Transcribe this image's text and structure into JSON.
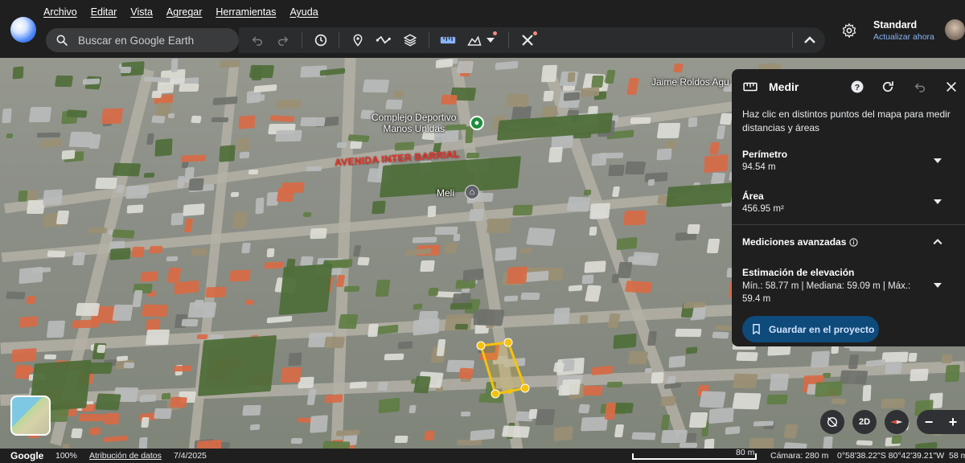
{
  "menu": [
    "Archivo",
    "Editar",
    "Vista",
    "Agregar",
    "Herramientas",
    "Ayuda"
  ],
  "search": {
    "placeholder": "Buscar en Google Earth"
  },
  "toolbar": {
    "icons": [
      "undo-icon",
      "redo-icon",
      "time-history-icon",
      "placemark-icon",
      "path-icon",
      "layers-icon",
      "ruler-icon",
      "data-layers-icon",
      "caret-down-icon",
      "measure-tools-icon",
      "collapse-icon"
    ]
  },
  "account": {
    "name": "Standard",
    "update_link": "Actualizar ahora"
  },
  "map": {
    "labels": {
      "complex_line1": "Complejo Deportivo",
      "complex_line2": "Manos Unidas",
      "avenue": "AVENIDA INTER BARRIAL",
      "meli": "Meli",
      "jaime": "Jaime Roldos Agu"
    }
  },
  "measure_panel": {
    "title": "Medir",
    "description": "Haz clic en distintos puntos del mapa para medir distancias y áreas",
    "perimeter_label": "Perímetro",
    "perimeter_value": "94.54 m",
    "area_label": "Área",
    "area_value": "456.95 m²",
    "advanced_label": "Mediciones avanzadas",
    "elevation_label": "Estimación de elevación",
    "elevation_value": "Mín.: 58.77 m | Mediana: 59.09 m | Máx.: 59.4 m",
    "save_label": "Guardar en el proyecto"
  },
  "map_controls": {
    "mode_2d": "2D"
  },
  "status": {
    "brand": "Google",
    "zoom": "100%",
    "attribution": "Atribución de datos",
    "date": "7/4/2025",
    "scale": "80 m",
    "camera": "Cámara: 280 m",
    "coords": "0°58'38.22\"S 80°42'39.21\"W",
    "elevation": "58 m"
  },
  "colors": {
    "chrome": "#1f1f1f",
    "accent_link": "#8ab4f8",
    "save_button": "#0e4a7a",
    "polygon_stroke": "#f4c20d",
    "avenue_text": "#e03b2d",
    "place_pin": "#1e8e3e"
  }
}
